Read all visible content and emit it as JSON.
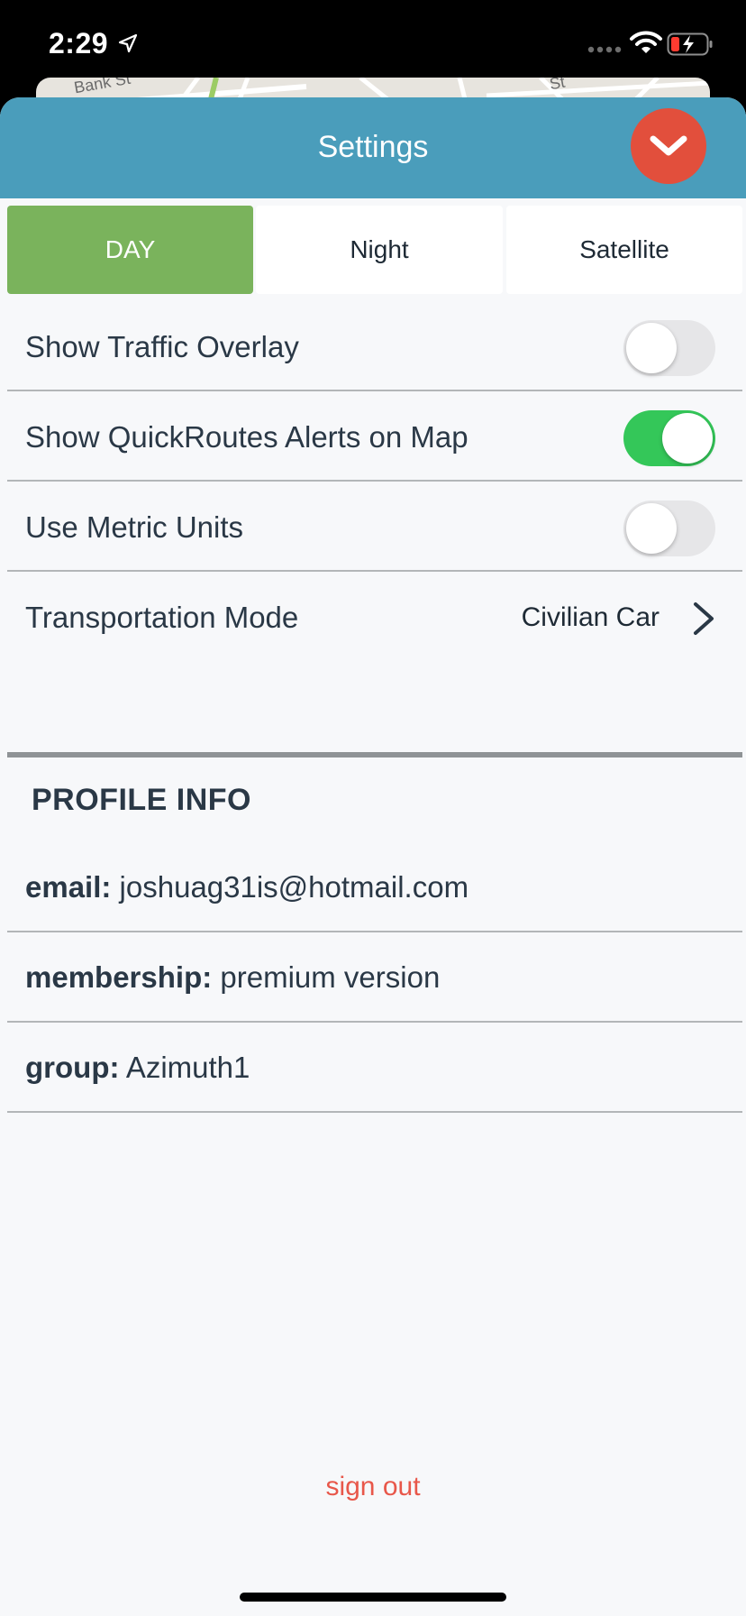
{
  "status_bar": {
    "time": "2:29"
  },
  "map_peek": {
    "street_labels": [
      "Bank St",
      "St"
    ]
  },
  "header": {
    "title": "Settings",
    "close_icon": "chevron-down-icon"
  },
  "map_style_tabs": [
    {
      "label": "DAY",
      "selected": true
    },
    {
      "label": "Night",
      "selected": false
    },
    {
      "label": "Satellite",
      "selected": false
    }
  ],
  "settings": {
    "traffic_overlay": {
      "label": "Show Traffic Overlay",
      "enabled": false
    },
    "quickroutes_alerts": {
      "label": "Show QuickRoutes Alerts on Map",
      "enabled": true
    },
    "metric_units": {
      "label": "Use Metric Units",
      "enabled": false
    },
    "transportation_mode": {
      "label": "Transportation Mode",
      "value": "Civilian Car"
    }
  },
  "profile": {
    "section_title": "PROFILE INFO",
    "email": {
      "key": "email:",
      "value": "joshuag31is@hotmail.com"
    },
    "membership": {
      "key": "membership:",
      "value": "premium version"
    },
    "group": {
      "key": "group:",
      "value": "Azimuth1"
    }
  },
  "sign_out_label": "sign out",
  "colors": {
    "header": "#4a9dbb",
    "close_button": "#e24f3c",
    "day_selected": "#7ab35c",
    "toggle_on": "#34c759",
    "sign_out": "#e8574a"
  }
}
